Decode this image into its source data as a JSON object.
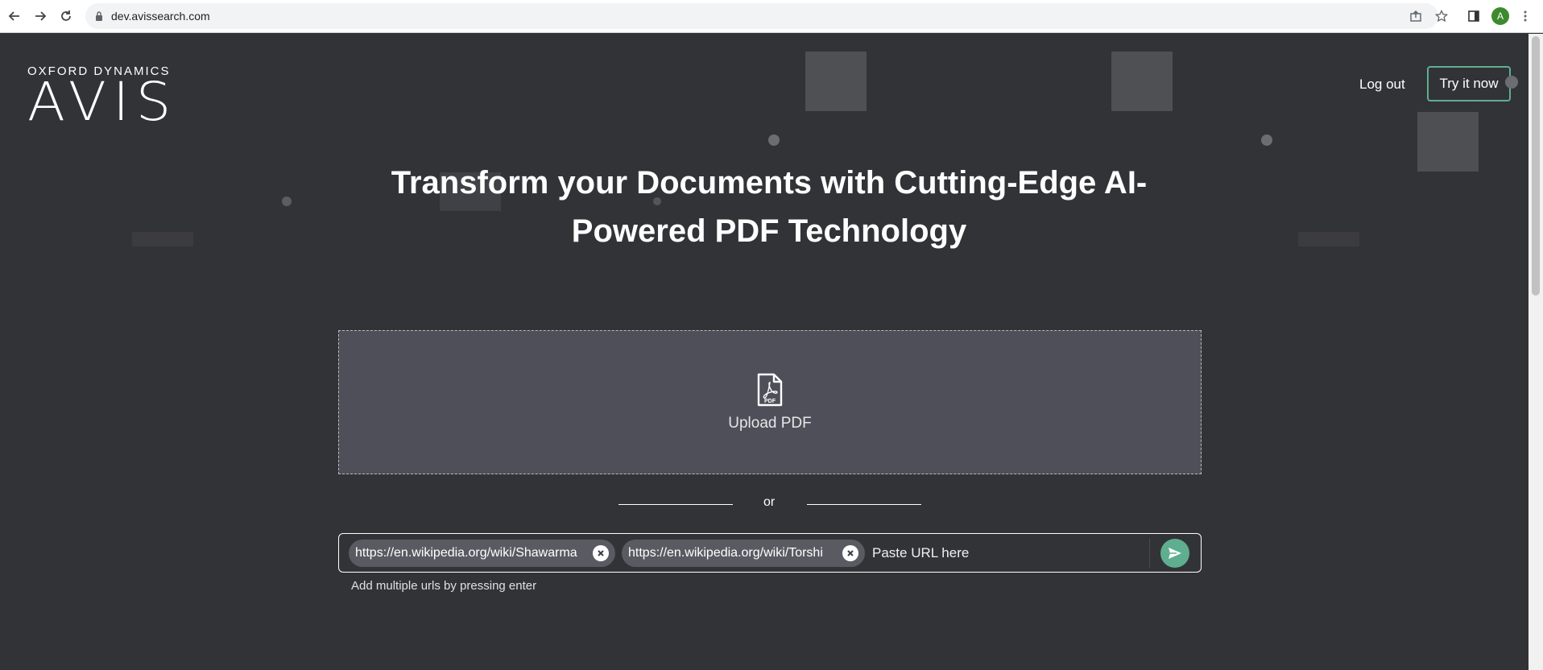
{
  "browser": {
    "url": "dev.avissearch.com",
    "profile_initial": "A"
  },
  "brand": {
    "company": "OXFORD DYNAMICS",
    "product": "AVIS"
  },
  "nav": {
    "logout_label": "Log out",
    "try_label": "Try it now"
  },
  "hero": {
    "title_line1": "Transform your Documents with Cutting-Edge AI-",
    "title_line2": "Powered PDF Technology"
  },
  "upload": {
    "label": "Upload PDF",
    "icon": "pdf-file-icon",
    "icon_text": "PDF"
  },
  "divider": {
    "or_text": "or"
  },
  "url_entry": {
    "chips": [
      "https://en.wikipedia.org/wiki/Shawarma",
      "https://en.wikipedia.org/wiki/Torshi"
    ],
    "placeholder": "Paste URL here",
    "value": "",
    "hint": "Add multiple urls by pressing enter"
  },
  "colors": {
    "background": "#323337",
    "upload_box": "#4e4f58",
    "accent": "#5fae8f"
  }
}
